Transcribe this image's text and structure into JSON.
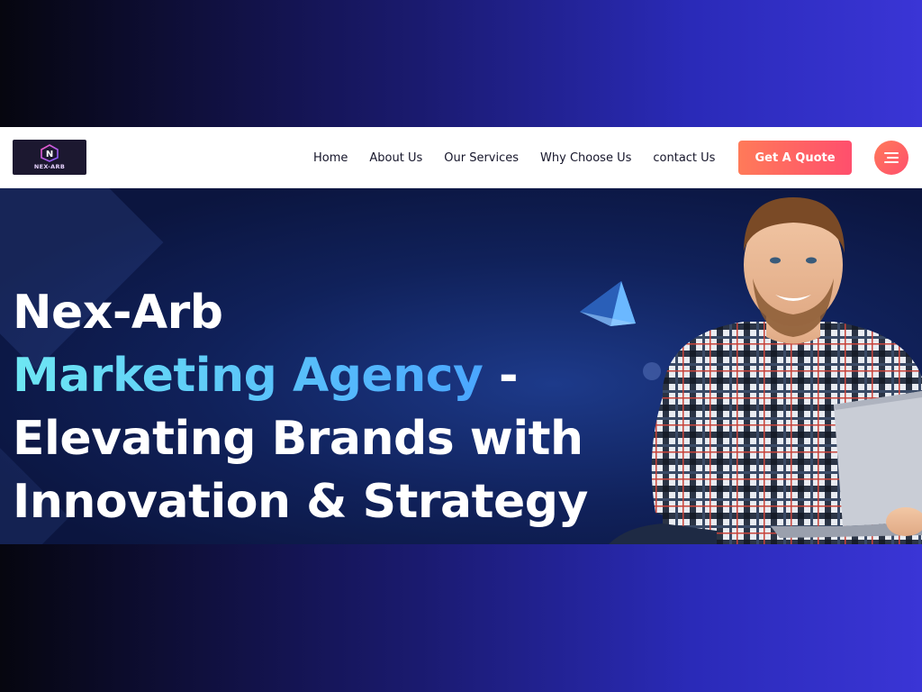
{
  "brand": {
    "logo_text": "NEX-ARB",
    "logo_letter": "N"
  },
  "nav": {
    "items": [
      {
        "label": "Home"
      },
      {
        "label": "About Us"
      },
      {
        "label": "Our Services"
      },
      {
        "label": "Why Choose Us"
      },
      {
        "label": "contact Us"
      }
    ],
    "cta_label": "Get A Quote",
    "menu_icon": "hamburger-menu-icon"
  },
  "hero": {
    "line1": "Nex-Arb",
    "line2_accent": "Marketing Agency",
    "line2_rest": " -",
    "line3": "Elevating Brands with",
    "line4": "Innovation & Strategy"
  },
  "colors": {
    "accent_gradient_start": "#ff7a59",
    "accent_gradient_end": "#ff4f6d",
    "headline_accent_start": "#6ee7f3",
    "headline_accent_end": "#4aa6ff",
    "hero_background": "#10215a"
  }
}
